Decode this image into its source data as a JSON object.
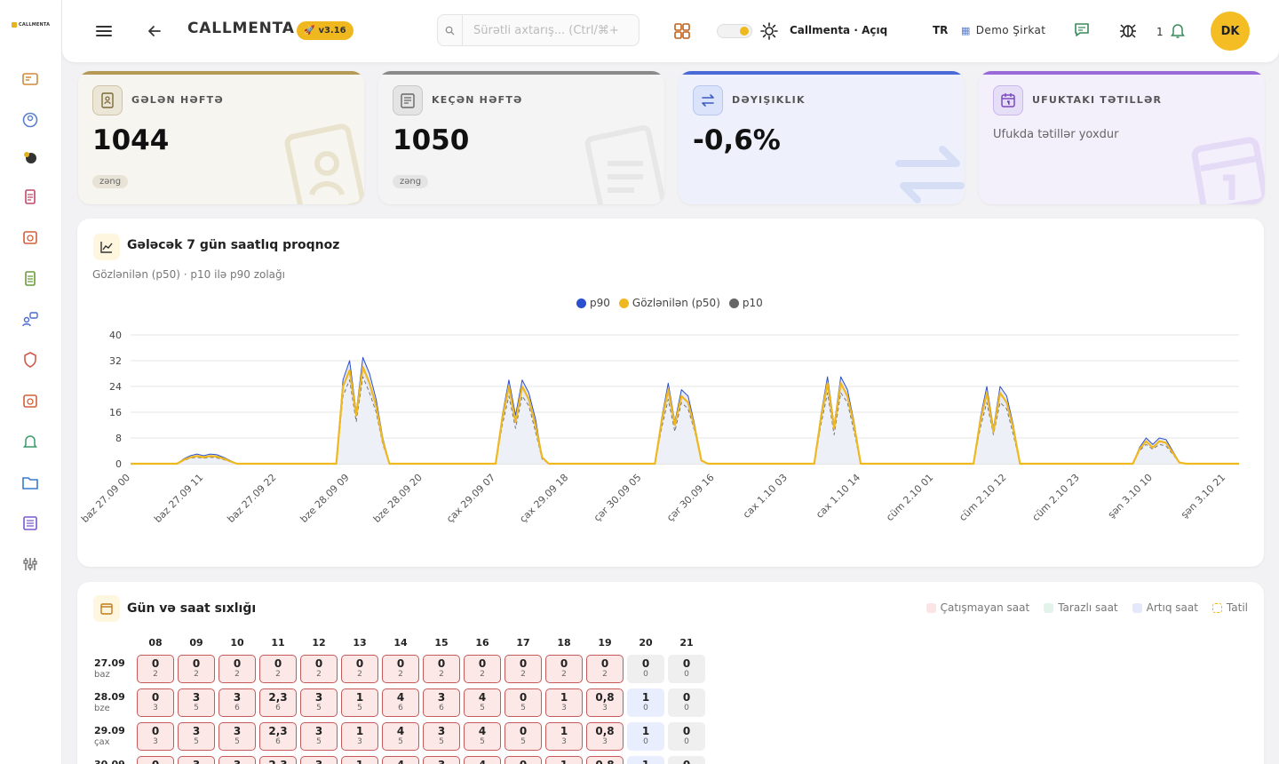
{
  "brand": {
    "logo_text": "CALLMENTA",
    "name": "CALLMENTA",
    "version": "v3.16"
  },
  "header": {
    "search_placeholder": "Sürətli axtarış... (Ctrl/⌘+",
    "theme_label": "Callmenta · Açıq",
    "language": "TR",
    "company": "Demo Şirkat",
    "notification_count": "1",
    "avatar_initials": "DK"
  },
  "colors": {
    "accent": "#f4bd24",
    "p90": "#2a4fcf",
    "p50": "#f0b81f",
    "p10": "#666666",
    "short": "#c45a5a"
  },
  "cards": [
    {
      "label": "GƏLƏN HƏFTƏ",
      "value": "1044",
      "unit": "zəng",
      "icon": "contacts-book-icon"
    },
    {
      "label": "KEÇƏN HƏFTƏ",
      "value": "1050",
      "unit": "zəng",
      "icon": "document-history-icon"
    },
    {
      "label": "DƏYIŞIKLIK",
      "value": "-0,6%",
      "icon": "swap-arrows-icon"
    },
    {
      "label": "UFUKTAKI TƏTILLƏR",
      "note": "Ufukda tətillər yoxdur",
      "icon": "calendar-icon"
    }
  ],
  "forecast": {
    "title": "Gələcək 7 gün saatlıq proqnoz",
    "subtitle": "Gözlənilən (p50) · p10 ilə p90 zolağı"
  },
  "chart_data": {
    "type": "area",
    "legend": [
      "p90",
      "Gözlənilən (p50)",
      "p10"
    ],
    "legend_position": "top-center",
    "ylim": [
      0,
      40
    ],
    "yticks": [
      0,
      8,
      16,
      24,
      32,
      40
    ],
    "xticks": [
      "baz 27.09 00",
      "baz 27.09 11",
      "baz 27.09 22",
      "bze 28.09 09",
      "bze 28.09 20",
      "çax 29.09 07",
      "çax 29.09 18",
      "çər 30.09 05",
      "çər 30.09 16",
      "cax 1.10 03",
      "cax 1.10 14",
      "cüm 2.10 01",
      "cüm 2.10 12",
      "cüm 2.10 23",
      "şən 3.10 10",
      "şən 3.10 21"
    ],
    "grid": true,
    "hours_per_day": 24,
    "series": [
      {
        "name": "p90",
        "values": [
          0,
          0,
          0,
          0,
          0,
          0,
          0,
          0,
          1.5,
          2.5,
          3,
          2.5,
          3,
          2.8,
          2,
          1,
          0,
          0,
          0,
          0,
          0,
          0,
          0,
          0,
          0,
          0,
          0,
          0,
          0,
          0,
          0,
          0,
          26,
          32,
          16,
          33,
          28,
          20,
          8,
          0,
          0,
          0,
          0,
          0,
          0,
          0,
          0,
          0,
          0,
          0,
          0,
          0,
          0,
          0,
          0,
          0,
          15,
          26,
          15,
          26,
          22,
          14,
          2,
          0,
          0,
          0,
          0,
          0,
          0,
          0,
          0,
          0,
          0,
          0,
          0,
          0,
          0,
          0,
          0,
          0,
          14,
          25,
          13,
          23,
          21,
          12,
          1,
          0,
          0,
          0,
          0,
          0,
          0,
          0,
          0,
          0,
          0,
          0,
          0,
          0,
          0,
          0,
          0,
          0,
          15,
          27,
          12,
          27,
          23,
          13,
          0,
          0,
          0,
          0,
          0,
          0,
          0,
          0,
          0,
          0,
          0,
          0,
          0,
          0,
          0,
          0,
          0,
          0,
          14,
          24,
          11,
          24,
          21,
          12,
          0,
          0,
          0,
          0,
          0,
          0,
          0,
          0,
          0,
          0,
          0,
          0,
          0,
          0,
          0,
          0,
          0,
          0,
          5,
          8,
          6,
          8,
          7.5,
          4,
          0.5,
          0,
          0,
          0,
          0,
          0,
          0,
          0,
          0,
          0
        ]
      },
      {
        "name": "Gözlənilən (p50)",
        "values": [
          0,
          0,
          0,
          0,
          0,
          0,
          0,
          0,
          1.2,
          2,
          2.4,
          2,
          2.4,
          2.2,
          1.6,
          0.8,
          0,
          0,
          0,
          0,
          0,
          0,
          0,
          0,
          0,
          0,
          0,
          0,
          0,
          0,
          0,
          0,
          24,
          29,
          15,
          30,
          25,
          18,
          7,
          0,
          0,
          0,
          0,
          0,
          0,
          0,
          0,
          0,
          0,
          0,
          0,
          0,
          0,
          0,
          0,
          0,
          14,
          24,
          13,
          24,
          20,
          12,
          2,
          0,
          0,
          0,
          0,
          0,
          0,
          0,
          0,
          0,
          0,
          0,
          0,
          0,
          0,
          0,
          0,
          0,
          13,
          23,
          12,
          21,
          19,
          11,
          1,
          0,
          0,
          0,
          0,
          0,
          0,
          0,
          0,
          0,
          0,
          0,
          0,
          0,
          0,
          0,
          0,
          0,
          14,
          25,
          11,
          25,
          21,
          12,
          0,
          0,
          0,
          0,
          0,
          0,
          0,
          0,
          0,
          0,
          0,
          0,
          0,
          0,
          0,
          0,
          0,
          0,
          13,
          22,
          10,
          22,
          19,
          11,
          0,
          0,
          0,
          0,
          0,
          0,
          0,
          0,
          0,
          0,
          0,
          0,
          0,
          0,
          0,
          0,
          0,
          0,
          4.5,
          7,
          5,
          7,
          6.5,
          3.5,
          0.4,
          0,
          0,
          0,
          0,
          0,
          0,
          0,
          0,
          0
        ]
      },
      {
        "name": "p10",
        "values": [
          0,
          0,
          0,
          0,
          0,
          0,
          0,
          0,
          1,
          1.7,
          2,
          1.7,
          2,
          1.8,
          1.3,
          0.6,
          0,
          0,
          0,
          0,
          0,
          0,
          0,
          0,
          0,
          0,
          0,
          0,
          0,
          0,
          0,
          0,
          21,
          26,
          13,
          27,
          22,
          16,
          6,
          0,
          0,
          0,
          0,
          0,
          0,
          0,
          0,
          0,
          0,
          0,
          0,
          0,
          0,
          0,
          0,
          0,
          12,
          21,
          11,
          21,
          18,
          10,
          1.5,
          0,
          0,
          0,
          0,
          0,
          0,
          0,
          0,
          0,
          0,
          0,
          0,
          0,
          0,
          0,
          0,
          0,
          11,
          20,
          10,
          19,
          17,
          10,
          1,
          0,
          0,
          0,
          0,
          0,
          0,
          0,
          0,
          0,
          0,
          0,
          0,
          0,
          0,
          0,
          0,
          0,
          12,
          22,
          9,
          22,
          19,
          10,
          0,
          0,
          0,
          0,
          0,
          0,
          0,
          0,
          0,
          0,
          0,
          0,
          0,
          0,
          0,
          0,
          0,
          0,
          11,
          19,
          9,
          19,
          17,
          9,
          0,
          0,
          0,
          0,
          0,
          0,
          0,
          0,
          0,
          0,
          0,
          0,
          0,
          0,
          0,
          0,
          0,
          0,
          4,
          6,
          4.5,
          6,
          5.5,
          3,
          0.3,
          0,
          0,
          0,
          0,
          0,
          0,
          0,
          0,
          0
        ]
      }
    ]
  },
  "heatmap": {
    "title": "Gün və saat sıxlığı",
    "legend": [
      "Çatışmayan saat",
      "Tarazlı saat",
      "Artıq saat",
      "Tatil"
    ],
    "hours": [
      "08",
      "09",
      "10",
      "11",
      "12",
      "13",
      "14",
      "15",
      "16",
      "17",
      "18",
      "19",
      "20",
      "21"
    ],
    "rows": [
      {
        "date": "27.09",
        "day": "baz",
        "cells": [
          [
            "0",
            "2"
          ],
          [
            "0",
            "2"
          ],
          [
            "0",
            "2"
          ],
          [
            "0",
            "2"
          ],
          [
            "0",
            "2"
          ],
          [
            "0",
            "2"
          ],
          [
            "0",
            "2"
          ],
          [
            "0",
            "2"
          ],
          [
            "0",
            "2"
          ],
          [
            "0",
            "2"
          ],
          [
            "0",
            "2"
          ],
          [
            "0",
            "2"
          ],
          [
            "0",
            "0"
          ],
          [
            "0",
            "0"
          ]
        ]
      },
      {
        "date": "28.09",
        "day": "bze",
        "cells": [
          [
            "0",
            "3"
          ],
          [
            "3",
            "5"
          ],
          [
            "3",
            "6"
          ],
          [
            "2,3",
            "6"
          ],
          [
            "3",
            "5"
          ],
          [
            "1",
            "5"
          ],
          [
            "4",
            "6"
          ],
          [
            "3",
            "6"
          ],
          [
            "4",
            "5"
          ],
          [
            "0",
            "5"
          ],
          [
            "1",
            "3"
          ],
          [
            "0,8",
            "3"
          ],
          [
            "1",
            "0"
          ],
          [
            "0",
            "0"
          ]
        ]
      },
      {
        "date": "29.09",
        "day": "çax",
        "cells": [
          [
            "0",
            "3"
          ],
          [
            "3",
            "5"
          ],
          [
            "3",
            "5"
          ],
          [
            "2,3",
            "6"
          ],
          [
            "3",
            "5"
          ],
          [
            "1",
            "3"
          ],
          [
            "4",
            "5"
          ],
          [
            "3",
            "5"
          ],
          [
            "4",
            "5"
          ],
          [
            "0",
            "5"
          ],
          [
            "1",
            "3"
          ],
          [
            "0,8",
            "3"
          ],
          [
            "1",
            "0"
          ],
          [
            "0",
            "0"
          ]
        ]
      },
      {
        "date": "30.09",
        "day": "çər",
        "cells": [
          [
            "0",
            "3"
          ],
          [
            "3",
            "5"
          ],
          [
            "3",
            "5"
          ],
          [
            "2,3",
            "6"
          ],
          [
            "3",
            "5"
          ],
          [
            "1",
            "3"
          ],
          [
            "4",
            "5"
          ],
          [
            "3",
            "5"
          ],
          [
            "4",
            "5"
          ],
          [
            "0",
            "5"
          ],
          [
            "1",
            "3"
          ],
          [
            "0,8",
            "3"
          ],
          [
            "1",
            "0"
          ],
          [
            "0",
            "0"
          ]
        ]
      }
    ]
  }
}
